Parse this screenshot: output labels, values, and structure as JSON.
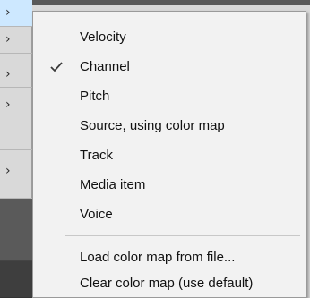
{
  "parent_menu": {
    "rows": [
      {
        "arrow": "›",
        "state": "highlight"
      },
      {
        "arrow": "›",
        "state": "normal"
      },
      {
        "arrow": "›",
        "state": "normal"
      },
      {
        "arrow": "›",
        "state": "normal"
      },
      {
        "arrow": "›",
        "state": "normal"
      },
      {
        "arrow": "›",
        "state": "normal"
      }
    ]
  },
  "context_menu": {
    "items": [
      {
        "label": "Velocity",
        "checked": false
      },
      {
        "label": "Channel",
        "checked": true
      },
      {
        "label": "Pitch",
        "checked": false
      },
      {
        "label": "Source, using color map",
        "checked": false
      },
      {
        "label": "Track",
        "checked": false
      },
      {
        "label": "Media item",
        "checked": false
      },
      {
        "label": "Voice",
        "checked": false
      }
    ],
    "actions": [
      {
        "label": "Load color map from file..."
      },
      {
        "label": "Clear color map (use default)"
      }
    ],
    "check_icon": "checkmark-icon",
    "check_color": "#3a3a3a"
  }
}
